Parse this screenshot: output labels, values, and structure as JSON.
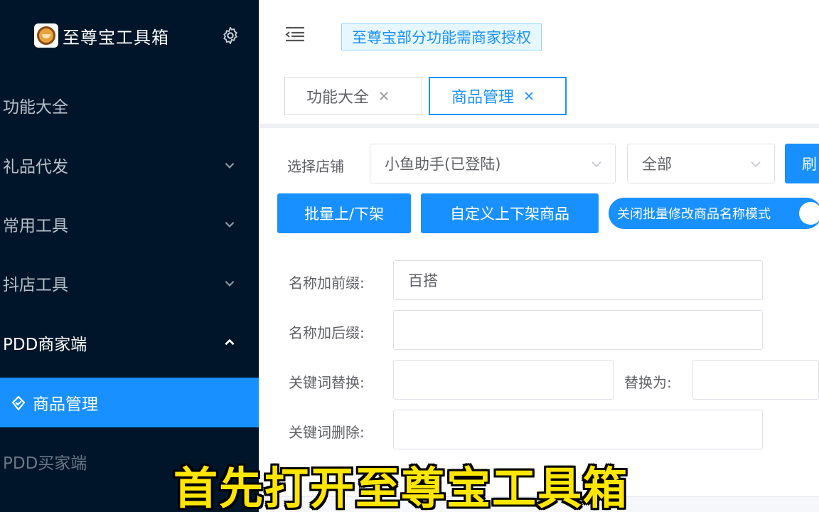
{
  "sidebar": {
    "brand_title": "至尊宝工具箱",
    "brand_icon": "monkey-logo-icon",
    "settings_icon": "gear-icon",
    "items": [
      {
        "label": "功能大全",
        "chevron": "none"
      },
      {
        "label": "礼品代发",
        "chevron": "down"
      },
      {
        "label": "常用工具",
        "chevron": "down"
      },
      {
        "label": "抖店工具",
        "chevron": "down"
      },
      {
        "label": "PDD商家端",
        "chevron": "up"
      },
      {
        "label": "商品管理",
        "active": true,
        "icon": "diamond-check-icon"
      },
      {
        "label": "PDD买家端",
        "chevron": "none"
      }
    ],
    "colors": {
      "background": "#001529",
      "active": "#1890ff"
    }
  },
  "header": {
    "collapse_icon": "menu-fold-icon",
    "notice": "至尊宝部分功能需商家授权"
  },
  "tabs": [
    {
      "label": "功能大全",
      "active": false
    },
    {
      "label": "商品管理",
      "active": true
    }
  ],
  "filters": {
    "store_label": "选择店铺",
    "store_value": "小鱼助手(已登陆)",
    "status_value": "全部",
    "refresh_label": "刷"
  },
  "actions": {
    "batch_toggle": "批量上/下架",
    "custom_toggle": "自定义上下架商品",
    "mode_switch": "关闭批量修改商品名称模式"
  },
  "form": {
    "prefix_label": "名称加前缀:",
    "prefix_value": "百搭",
    "suffix_label": "名称加后缀:",
    "suffix_value": "",
    "keyword_replace_label": "关键词替换:",
    "keyword_replace_value": "",
    "replace_with_label": "替换为:",
    "replace_with_value": "",
    "keyword_delete_label": "关键词删除:",
    "keyword_delete_value": ""
  },
  "caption": "首先打开至尊宝工具箱"
}
